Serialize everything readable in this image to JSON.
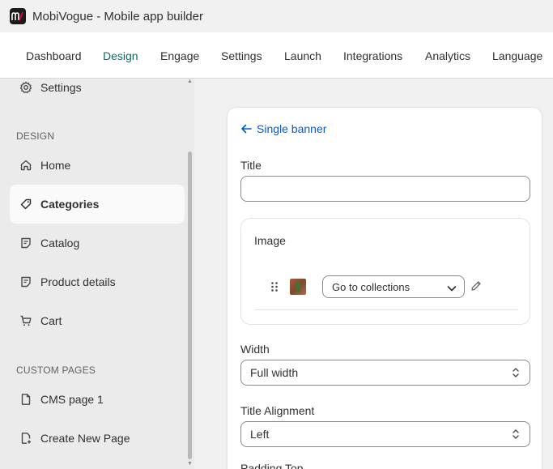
{
  "app": {
    "title": "MobiVogue - Mobile app builder",
    "logo_text": "m/"
  },
  "topnav": {
    "tabs": [
      {
        "label": "Dashboard"
      },
      {
        "label": "Design"
      },
      {
        "label": "Engage"
      },
      {
        "label": "Settings"
      },
      {
        "label": "Launch"
      },
      {
        "label": "Integrations"
      },
      {
        "label": "Analytics"
      },
      {
        "label": "Language"
      }
    ],
    "active": "Design",
    "active_color": "#0f6b63"
  },
  "sidebar": {
    "top_item": {
      "label": "Settings",
      "icon": "gear-icon"
    },
    "design_heading": "DESIGN",
    "design_items": [
      {
        "label": "Home",
        "icon": "home-icon"
      },
      {
        "label": "Categories",
        "icon": "tag-icon",
        "selected": true
      },
      {
        "label": "Catalog",
        "icon": "catalog-icon"
      },
      {
        "label": "Product details",
        "icon": "catalog-icon"
      },
      {
        "label": "Cart",
        "icon": "cart-icon"
      }
    ],
    "custom_heading": "CUSTOM PAGES",
    "custom_items": [
      {
        "label": "CMS page 1",
        "icon": "page-icon"
      },
      {
        "label": "Create New Page",
        "icon": "page-add-icon"
      }
    ]
  },
  "editor": {
    "back_label": "Single banner",
    "title_label": "Title",
    "title_value": "",
    "image_label": "Image",
    "image_link_select": "Go to collections",
    "width_label": "Width",
    "width_value": "Full width",
    "alignment_label": "Title Alignment",
    "alignment_value": "Left",
    "next_label_partial": "Padding Top"
  },
  "colors": {
    "link": "#005bd3",
    "brand_dark": "#1b1b1b",
    "brand_accent": "#e4003a"
  }
}
